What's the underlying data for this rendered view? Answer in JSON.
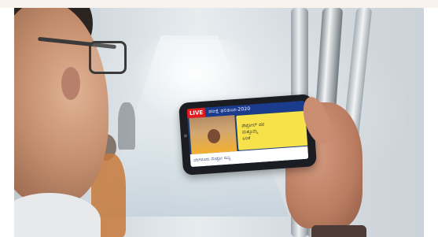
{
  "scene": {
    "description_free": true
  },
  "phone_screen": {
    "live_label": "LIVE",
    "topbar_text": "ಪರೀಕ್ಷೆ ಫಲಿತಾಂಶ-2020",
    "headline_lines": [
      "ಪೆಟ್ರೋಲ್ ದರ",
      "ಮತ್ತೊಮ್ಮೆ",
      "ಏರಿಕೆ"
    ],
    "ticker_text": "ಬೆಂಗಳೂರು ಮೆಟ್ರೋ ಸುದ್ದಿ"
  },
  "colors": {
    "live_badge": "#e31b1b",
    "headline_bg": "#f7e24b",
    "channel_blue": "#1b3b8d"
  }
}
